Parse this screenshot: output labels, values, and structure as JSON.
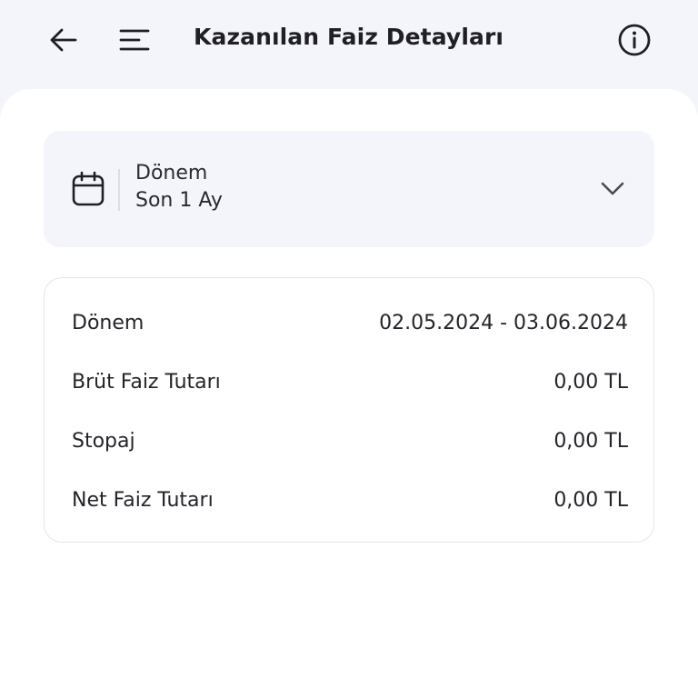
{
  "header": {
    "title": "Kazanılan Faiz Detayları",
    "back_icon": "arrow-left-icon",
    "menu_icon": "hamburger-menu-icon",
    "info_icon": "info-icon"
  },
  "period_select": {
    "icon": "calendar-icon",
    "label": "Dönem",
    "value": "Son 1 Ay",
    "chevron_icon": "chevron-down-icon"
  },
  "details": {
    "rows": [
      {
        "label": "Dönem",
        "value": "02.05.2024 - 03.06.2024"
      },
      {
        "label": "Brüt Faiz Tutarı",
        "value": "0,00 TL"
      },
      {
        "label": "Stopaj",
        "value": "0,00 TL"
      },
      {
        "label": "Net Faiz Tutarı",
        "value": "0,00 TL"
      }
    ]
  },
  "colors": {
    "background": "#f4f5fb",
    "card": "#ffffff",
    "text": "#1f1f24",
    "border": "#e4e5ec"
  }
}
